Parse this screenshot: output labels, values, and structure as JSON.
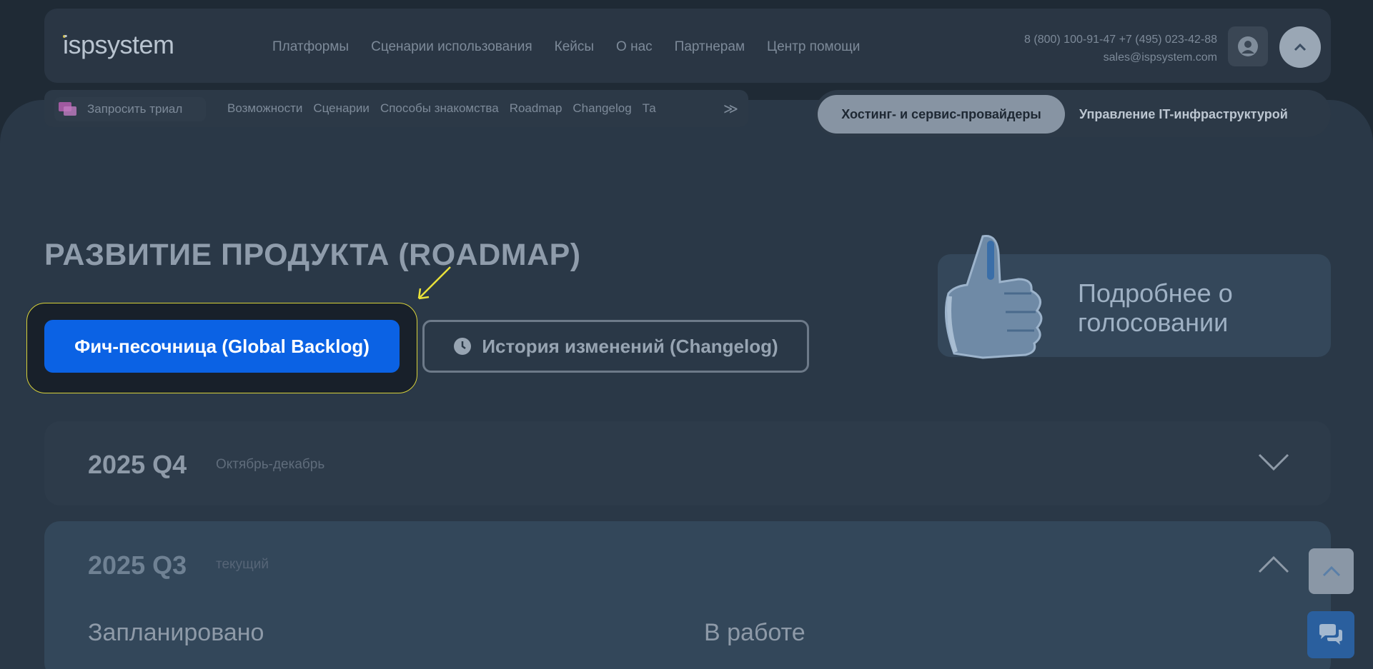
{
  "header": {
    "logo": "ispsystem",
    "nav": [
      "Платформы",
      "Сценарии использования",
      "Кейсы",
      "О нас",
      "Партнерам",
      "Центр помощи"
    ],
    "phones": "8 (800) 100-91-47 +7 (495) 023-42-88",
    "email": "sales@ispsystem.com"
  },
  "subnav": {
    "trial": "Запросить триал",
    "links": [
      "Возможности",
      "Сценарии",
      "Способы знакомства",
      "Roadmap",
      "Changelog",
      "Та"
    ],
    "segment_active": "Хостинг- и сервис-провайдеры",
    "segment_inactive": "Управление IT-инфраструктурой"
  },
  "main": {
    "title": "РАЗВИТИЕ ПРОДУКТА (ROADMAP)",
    "primary_button": "Фич-песочница (Global Backlog)",
    "changelog_button": "История изменений (Changelog)",
    "vote_card": {
      "line1": "Подробнее о",
      "line2": "голосовании"
    }
  },
  "quarters": [
    {
      "title": "2025 Q4",
      "subtitle": "Октябрь-декабрь",
      "expanded": false
    },
    {
      "title": "2025 Q3",
      "subtitle": "текущий",
      "expanded": true,
      "columns": [
        "Запланировано",
        "В работе"
      ]
    }
  ],
  "colors": {
    "primary": "#0b62e4",
    "highlight_border": "#d8d23a",
    "annotation_arrow": "#e8e03a"
  }
}
